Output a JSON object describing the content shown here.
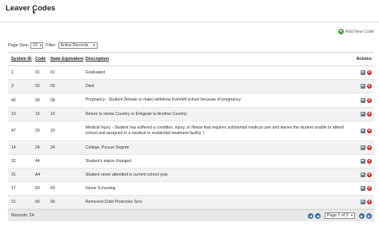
{
  "page": {
    "title": "Leaver Codes"
  },
  "toolbar": {
    "add_label": "Add New Code"
  },
  "controls": {
    "page_size_label": "Page Size:",
    "page_size_value": "10",
    "filter_label": "Filter:",
    "filter_value": "Active Records"
  },
  "table": {
    "headers": {
      "system_id": "System ID",
      "code": "Code",
      "state_equivalent": "State Equivalent",
      "description": "Description",
      "actions": "Actions"
    },
    "rows": [
      {
        "system_id": "1",
        "code": "01",
        "state": "01",
        "description": "Graduated"
      },
      {
        "system_id": "3",
        "code": "03",
        "state": "03",
        "description": "Died"
      },
      {
        "system_id": "46",
        "code": "08",
        "state": "08",
        "description": "Pregnancy - Student (female or male) withdrew from/left school because of pregnancy."
      },
      {
        "system_id": "10",
        "code": "16",
        "state": "16",
        "description": "Return to Home Country or Emigrate to Another Country"
      },
      {
        "system_id": "47",
        "code": "20",
        "state": "20",
        "description": "Medical Injury - Student has suffered a condition, injury, or illness that requires substantial medical care and leaves the student unable to attend school and assigned to a medical or residential treatment facility. )"
      },
      {
        "system_id": "14",
        "code": "24",
        "state": "24",
        "description": "College, Pursue Degree"
      },
      {
        "system_id": "32",
        "code": "44",
        "state": "",
        "description": "Student's status changed"
      },
      {
        "system_id": "31",
        "code": "A4",
        "state": "",
        "description": "Student never attended in current school year"
      },
      {
        "system_id": "17",
        "code": "60",
        "state": "60",
        "description": "Home Schooling"
      },
      {
        "system_id": "21",
        "code": "66",
        "state": "66",
        "description": "Removed-Child Protective Srvs"
      }
    ]
  },
  "footer": {
    "records_label": "Records: 24",
    "page_value": "Page 1 of 3"
  },
  "icons": {
    "add": "plus-circle-icon",
    "edit": "edit-icon",
    "delete": "delete-icon",
    "first": "first-page-icon",
    "prev": "prev-page-icon",
    "next": "next-page-icon",
    "last": "last-page-icon"
  },
  "colors": {
    "add_green": "#3d9b3d",
    "delete_red": "#c8302e",
    "pager_blue": "#3a6fb0",
    "alt_row": "#f2f2f2",
    "footer_bg": "#e8e8e8"
  }
}
